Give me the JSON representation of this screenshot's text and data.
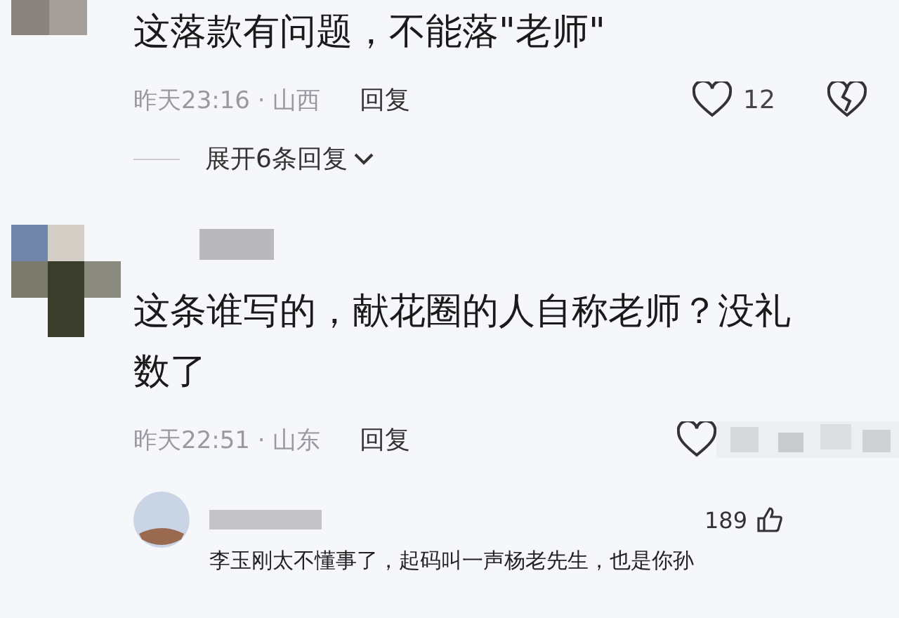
{
  "comments": [
    {
      "kind": "top",
      "text": "这落款有问题，不能落\"老师\"",
      "meta": "昨天23:16 · 山西",
      "reply": "回复",
      "likes": "12",
      "expand": "展开6条回复"
    },
    {
      "kind": "full",
      "text": "这条谁写的，献花圈的人自称老师？没礼数了",
      "meta": "昨天22:51 · 山东",
      "reply": "回复"
    }
  ],
  "sub_reply": {
    "likes": "189",
    "text": "李玉刚太不懂事了，起码叫一声杨老先生，也是你孙"
  }
}
